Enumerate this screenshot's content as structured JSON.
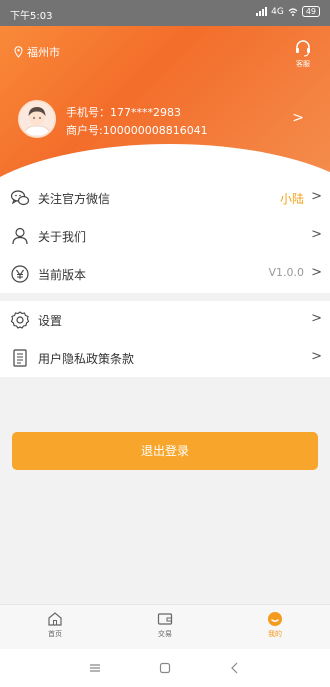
{
  "status_bar": {
    "time": "下午5:03",
    "network": "4G",
    "battery": "49"
  },
  "header": {
    "location": "福州市",
    "service_label": "客服"
  },
  "profile": {
    "phone": "手机号：177****2983",
    "merchant": "商户号:100000008816041",
    "arrow": ">"
  },
  "menu_group_1": [
    {
      "label": "关注官方微信",
      "value": "小陆",
      "arrow": ">",
      "icon": "wechat-icon"
    },
    {
      "label": "关于我们",
      "value": "",
      "arrow": ">",
      "icon": "person-icon"
    },
    {
      "label": "当前版本",
      "value": "V1.0.0",
      "arrow": ">",
      "icon": "version-icon"
    }
  ],
  "menu_group_2": [
    {
      "label": "设置",
      "arrow": ">",
      "icon": "gear-icon"
    },
    {
      "label": "用户隐私政策条款",
      "arrow": ">",
      "icon": "document-icon"
    }
  ],
  "logout_label": "退出登录",
  "tabs": [
    {
      "label": "首页",
      "icon": "home-icon",
      "active": false
    },
    {
      "label": "交易",
      "icon": "wallet-icon",
      "active": false
    },
    {
      "label": "我的",
      "icon": "user-icon",
      "active": true
    }
  ],
  "colors": {
    "accent": "#F7A62B",
    "header_orange": "#F36D2A",
    "active_tab": "#F49A1C"
  }
}
